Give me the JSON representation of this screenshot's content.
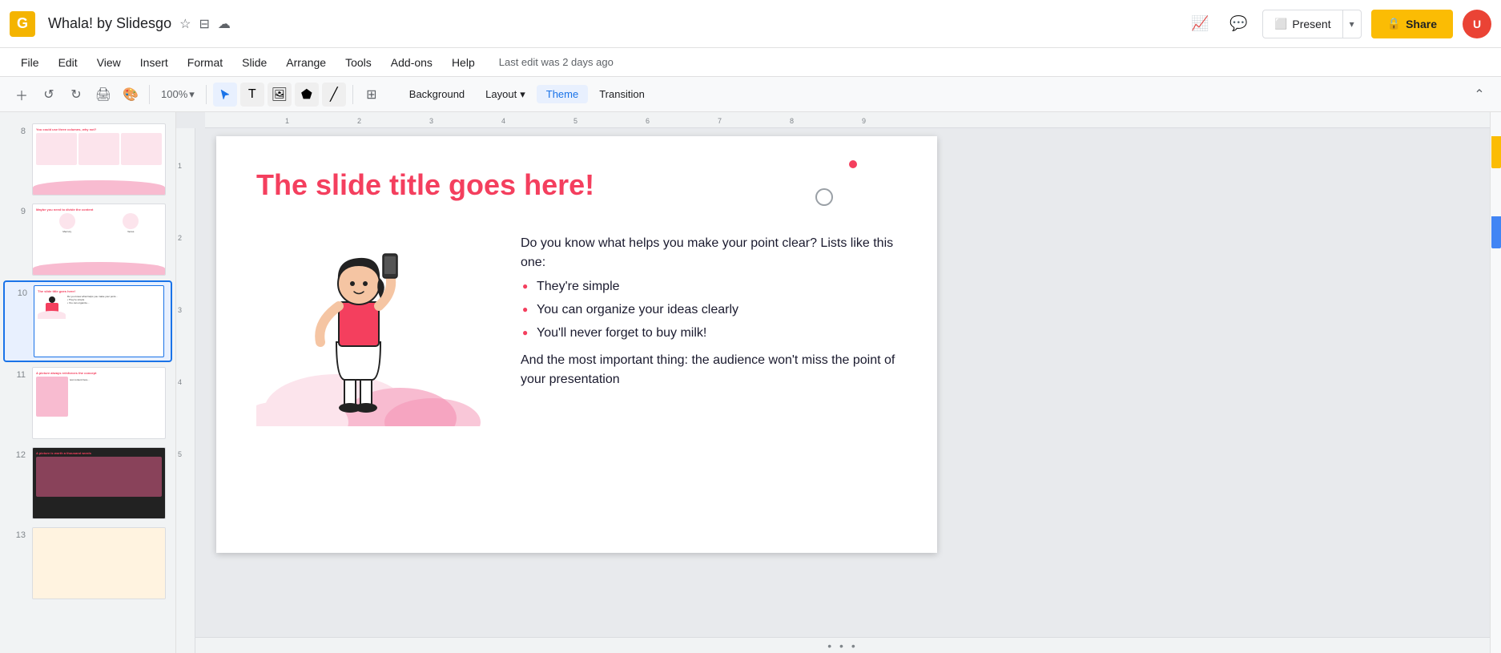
{
  "app": {
    "icon": "G",
    "title": "Whala! by Slidesgo",
    "last_edit": "Last edit was 2 days ago"
  },
  "topbar": {
    "star_icon": "☆",
    "folder_icon": "⊟",
    "cloud_icon": "☁",
    "present_label": "Present",
    "share_label": "Share",
    "lock_icon": "🔒",
    "avatar_initials": "U"
  },
  "menu": {
    "items": [
      "File",
      "Edit",
      "View",
      "Insert",
      "Format",
      "Slide",
      "Arrange",
      "Tools",
      "Add-ons",
      "Help"
    ]
  },
  "toolbar": {
    "zoom_label": "100%",
    "bg_button": "Background",
    "layout_button": "Layout",
    "theme_button": "Theme",
    "transition_button": "Transition"
  },
  "slide": {
    "title": "The slide title goes here!",
    "paragraph1": "Do you know what helps you make your point clear? Lists like this one:",
    "bullet1": "They're simple",
    "bullet2": "You can organize your ideas clearly",
    "bullet3": "You'll never forget to buy milk!",
    "paragraph2": "And the most important thing: the audience won't miss the point of your presentation"
  },
  "slides": [
    {
      "num": "8",
      "active": false
    },
    {
      "num": "9",
      "active": false
    },
    {
      "num": "10",
      "active": true
    },
    {
      "num": "11",
      "active": false
    },
    {
      "num": "12",
      "active": false
    },
    {
      "num": "13",
      "active": false
    }
  ],
  "colors": {
    "pink": "#f43f5e",
    "light_pink": "#fce4ec",
    "dark_text": "#1a1a2e",
    "accent_yellow": "#fbbc04"
  }
}
